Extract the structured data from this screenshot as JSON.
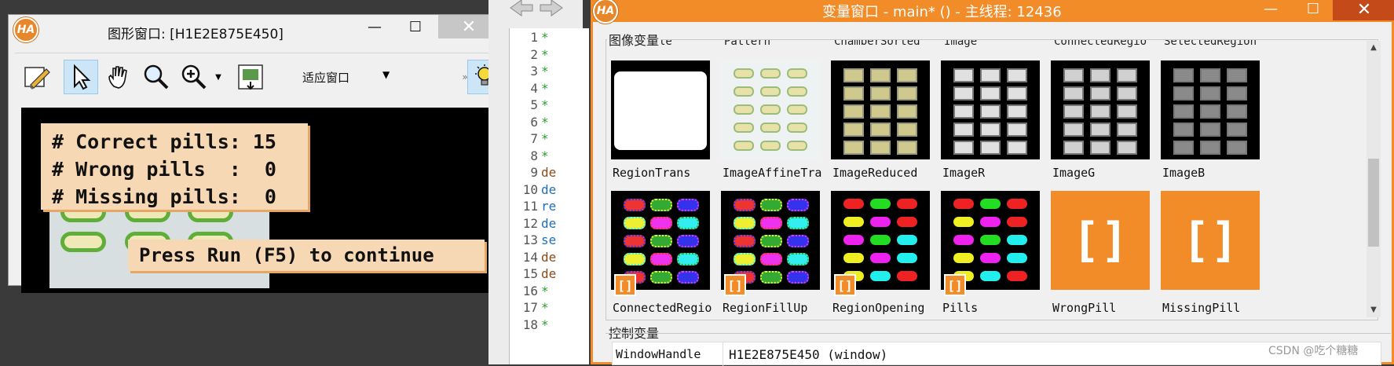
{
  "graphics_window": {
    "title": "图形窗口: [H1E2E875E450]",
    "logo": "HA",
    "close_glyph": "✕",
    "minimize_glyph": "—",
    "maximize_glyph": "☐",
    "toolbar": {
      "fit_label": "适应窗口",
      "fit_arrow": "▼"
    },
    "overlay": {
      "line1": "# Correct pills: 15",
      "line2": "# Wrong pills  :  0",
      "line3": "# Missing pills:  0",
      "continue": "Press Run (F5) to continue"
    }
  },
  "editor": {
    "lines": [
      {
        "n": "1",
        "text": "*",
        "kind": "cm"
      },
      {
        "n": "2",
        "text": "*",
        "kind": "cm"
      },
      {
        "n": "3",
        "text": "*",
        "kind": "cm"
      },
      {
        "n": "4",
        "text": "*",
        "kind": "cm"
      },
      {
        "n": "5",
        "text": "*",
        "kind": "cm"
      },
      {
        "n": "6",
        "text": "*",
        "kind": "cm"
      },
      {
        "n": "7",
        "text": "*",
        "kind": "cm"
      },
      {
        "n": "8",
        "text": "*",
        "kind": "cm"
      },
      {
        "n": "9",
        "text": "de",
        "kind": "kw"
      },
      {
        "n": "10",
        "text": "de",
        "kind": "code"
      },
      {
        "n": "11",
        "text": "re",
        "kind": "code"
      },
      {
        "n": "12",
        "text": "de",
        "kind": "code"
      },
      {
        "n": "13",
        "text": "se",
        "kind": "code"
      },
      {
        "n": "14",
        "text": "de",
        "kind": "kw"
      },
      {
        "n": "15",
        "text": "de",
        "kind": "kw"
      },
      {
        "n": "16",
        "text": "*",
        "kind": "cm"
      },
      {
        "n": "17",
        "text": "*",
        "kind": "cm"
      },
      {
        "n": "18",
        "text": "*",
        "kind": "cm"
      }
    ]
  },
  "variable_window": {
    "title": "变量窗口 - main* () - 主线程: 12436",
    "logo": "HA",
    "close_glyph": "✕",
    "minimize_glyph": "—",
    "maximize_glyph": "☐",
    "image_group_label": "图像变量",
    "control_group_label": "控制变量",
    "cut_top_labels": [
      "Rectangle",
      "Pattern",
      "ChamberSorted",
      "Image",
      "ConnectedRegio",
      "SelectedRegion"
    ],
    "row1": [
      "RegionTrans",
      "ImageAffineTra",
      "ImageReduced",
      "ImageR",
      "ImageG",
      "ImageB"
    ],
    "row2": [
      "ConnectedRegio",
      "RegionFillUp",
      "RegionOpening",
      "Pills",
      "WrongPill",
      "MissingPill"
    ],
    "placeholder_glyph": "[]",
    "control": {
      "name": "WindowHandle",
      "value": "H1E2E875E450 (window)"
    },
    "scroll_up": "▲",
    "scroll_down": "▼"
  },
  "watermark": "CSDN @吃个糖糖"
}
